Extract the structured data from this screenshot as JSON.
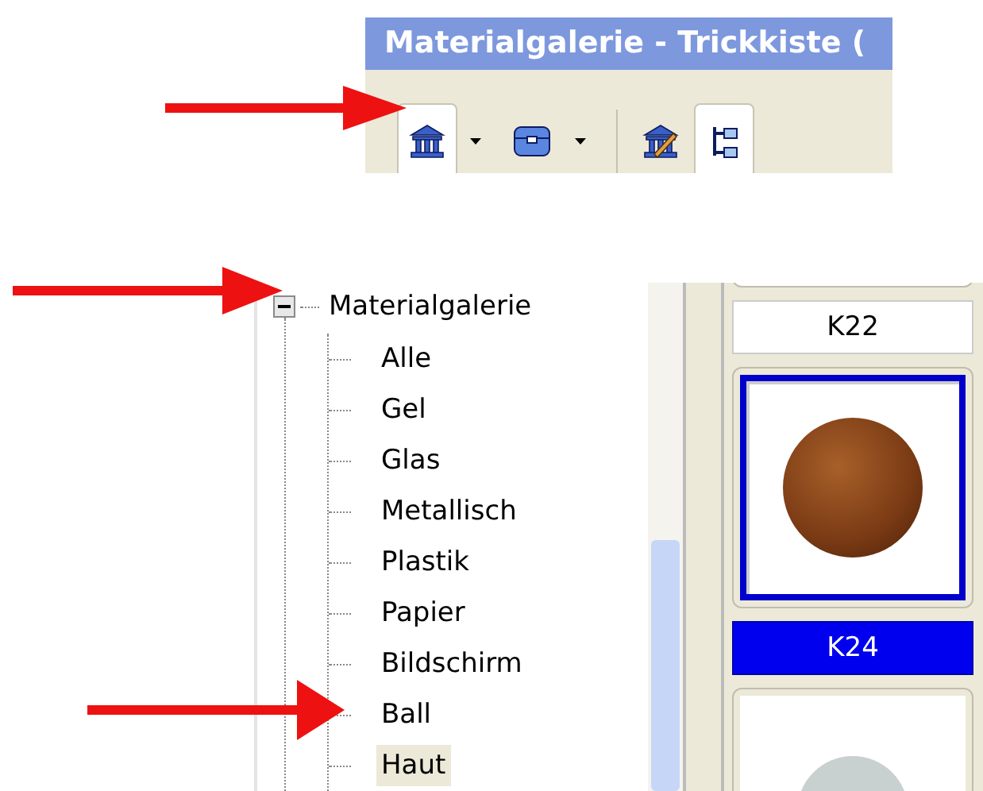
{
  "window": {
    "title": "Materialgalerie - Trickkiste ("
  },
  "toolbar": [
    {
      "kind": "gallery",
      "selected": true,
      "dropdown": true
    },
    {
      "kind": "chest",
      "selected": false,
      "dropdown": true
    },
    {
      "kind": "edit",
      "selected": false,
      "dropdown": false
    },
    {
      "kind": "tree",
      "selected": true,
      "dropdown": false
    }
  ],
  "tree": {
    "label": "Materialgalerie",
    "expanded": true,
    "children": [
      {
        "label": "Alle",
        "selected": false
      },
      {
        "label": "Gel",
        "selected": false
      },
      {
        "label": "Glas",
        "selected": false
      },
      {
        "label": "Metallisch",
        "selected": false
      },
      {
        "label": "Plastik",
        "selected": false
      },
      {
        "label": "Papier",
        "selected": false
      },
      {
        "label": "Bildschirm",
        "selected": false
      },
      {
        "label": "Ball",
        "selected": false
      },
      {
        "label": "Haut",
        "selected": true
      }
    ]
  },
  "gallery": [
    {
      "label": "K22",
      "kind": "caption",
      "selected": false
    },
    {
      "label": "K24",
      "kind": "wood",
      "selected": true
    }
  ]
}
